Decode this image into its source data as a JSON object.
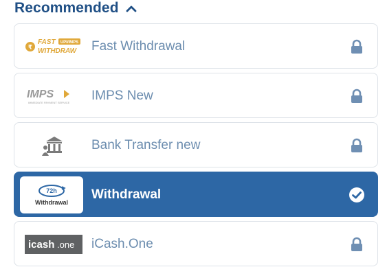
{
  "header": {
    "title": "Recommended"
  },
  "methods": [
    {
      "name": "Fast Withdrawal",
      "logo_text_top": "FAST",
      "logo_text_bottom": "WITHDRAW",
      "logo_badge": "UPI/IMPS",
      "locked": true
    },
    {
      "name": "IMPS New",
      "logo_text": "IMPS",
      "logo_subtext": "IMMEDIATE PAYMENT SERVICE",
      "locked": true
    },
    {
      "name": "Bank Transfer new",
      "locked": true
    },
    {
      "name": "Withdrawal",
      "logo_top": "72h",
      "logo_bottom": "Withdrawal",
      "selected": true
    },
    {
      "name": "iCash.One",
      "logo_text": "icash",
      "logo_suffix": ".one",
      "locked": true
    }
  ],
  "colors": {
    "accent": "#2d67a5",
    "header": "#1f4f85",
    "label": "#6c8daf",
    "lock": "#6f8fb3",
    "gold": "#e0a83a"
  }
}
